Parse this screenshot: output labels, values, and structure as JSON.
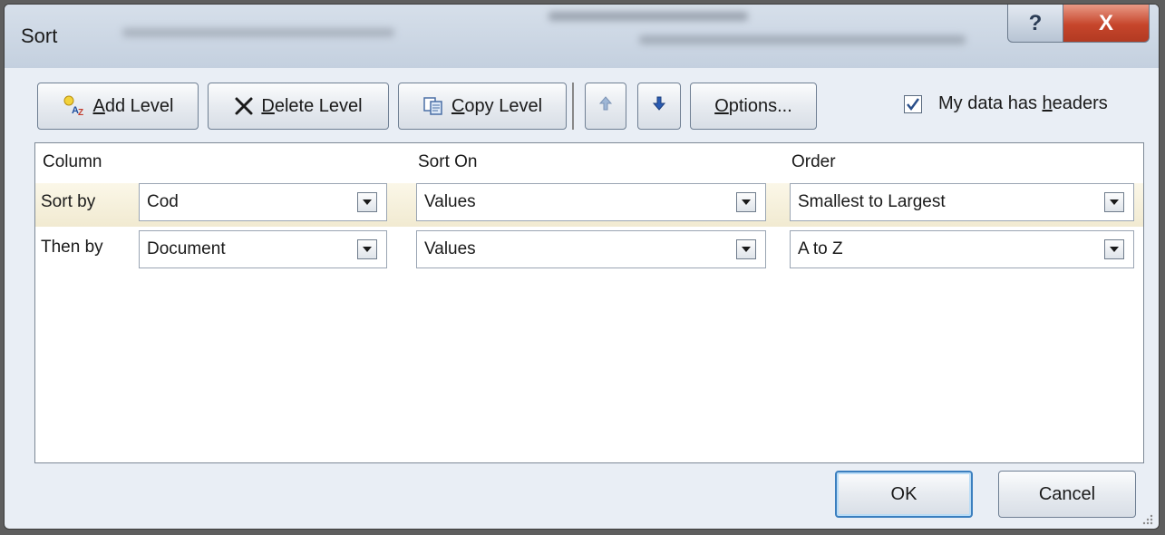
{
  "window": {
    "title": "Sort",
    "help_label": "?",
    "close_label": "X"
  },
  "toolbar": {
    "add_level_prefix": "",
    "add_level_mnemonic": "A",
    "add_level_rest": "dd Level",
    "delete_level_mnemonic": "D",
    "delete_level_rest": "elete Level",
    "copy_level_mnemonic": "C",
    "copy_level_rest": "opy Level",
    "options_mnemonic": "O",
    "options_rest": "ptions...",
    "headers_pre": "My data has ",
    "headers_mnemonic": "h",
    "headers_rest": "eaders",
    "headers_checked": true
  },
  "grid": {
    "columns": [
      "Column",
      "Sort On",
      "Order"
    ],
    "rows": [
      {
        "label": "Sort by",
        "column": "Cod",
        "sort_on": "Values",
        "order": "Smallest to Largest"
      },
      {
        "label": "Then by",
        "column": "Document",
        "sort_on": "Values",
        "order": "A to Z"
      }
    ]
  },
  "buttons": {
    "ok": "OK",
    "cancel": "Cancel"
  },
  "colors": {
    "close_red": "#c6452b",
    "selected_row": "#f1ead1",
    "ok_focus": "#3b7fbf"
  }
}
